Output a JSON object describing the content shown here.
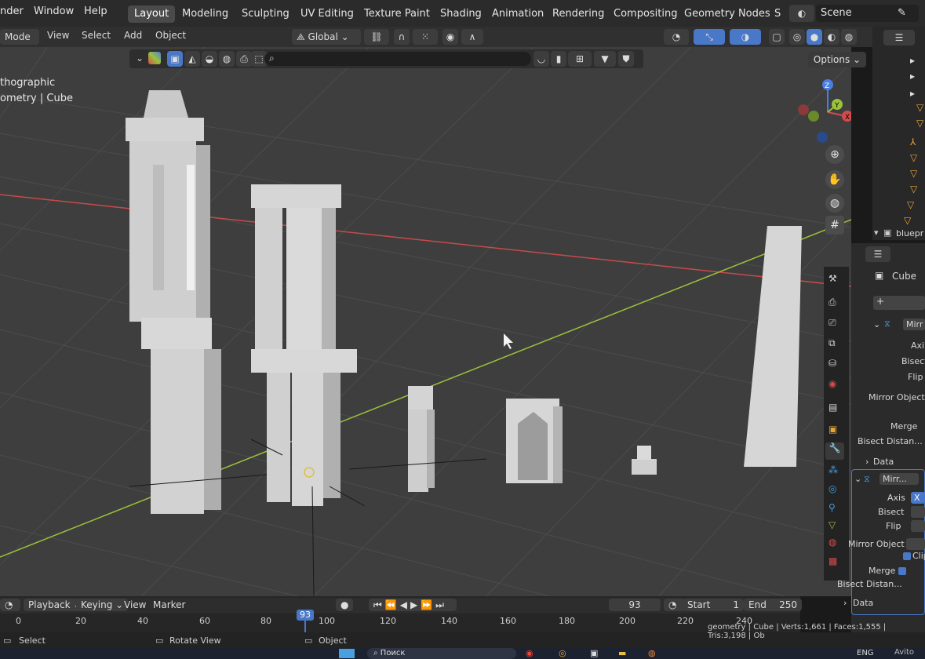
{
  "topbar": {
    "menus": [
      "nder",
      "Window",
      "Help"
    ],
    "workspaces": [
      "Layout",
      "Modeling",
      "Sculpting",
      "UV Editing",
      "Texture Paint",
      "Shading",
      "Animation",
      "Rendering",
      "Compositing",
      "Geometry Nodes",
      "S"
    ],
    "active_workspace": "Layout",
    "scene_label": "Scene"
  },
  "header": {
    "mode": "Mode",
    "menus": [
      "View",
      "Select",
      "Add",
      "Object"
    ],
    "transform_orientation": "Global",
    "options_label": "Options"
  },
  "viewport": {
    "view_name": "thographic",
    "collection_object": "ometry | Cube",
    "gizmo_axes": [
      "Z",
      "Y",
      "X"
    ],
    "nav_icons": [
      "zoom-icon",
      "hand-icon",
      "camera-icon",
      "grid-icon"
    ]
  },
  "timeline": {
    "menus": [
      "Playback",
      "Keying",
      "View",
      "Marker"
    ],
    "current_frame": "93",
    "start_label": "Start",
    "start_value": "1",
    "end_label": "End",
    "end_value": "250",
    "ticks": [
      "0",
      "20",
      "40",
      "60",
      "80",
      "100",
      "120",
      "140",
      "160",
      "180",
      "200",
      "220",
      "240"
    ]
  },
  "status": {
    "left_action": "Select",
    "mid_action": "Rotate View",
    "right_action": "Object",
    "info": "geometry | Cube | Verts:1,661 | Faces:1,555 | Tris:3,198 | Ob"
  },
  "taskbar": {
    "search": "Поиск",
    "lang": "ENG",
    "watermark": "Avito"
  },
  "outliner": {
    "last_item": "bluepr"
  },
  "properties": {
    "object_name": "Cube",
    "modifier1": {
      "name": "Mirr",
      "axis_label": "Axi",
      "bisect_label": "Bisect",
      "flip_label": "Flip",
      "mirror_object_label": "Mirror Object",
      "merge_label": "Merge",
      "bisect_distance_label": "Bisect Distan...",
      "data_label": "Data"
    },
    "modifier2": {
      "name": "Mirr...",
      "axis_label": "Axis",
      "bisect_label": "Bisect",
      "flip_label": "Flip",
      "axis_value": "X",
      "mirror_object_label": "Mirror Object",
      "clip_label": "Clip",
      "merge_label": "Merge",
      "bisect_distance_label": "Bisect Distan...",
      "data_label": "Data"
    }
  },
  "colors": {
    "accent": "#4a78c8",
    "x_axis": "#d44b4b",
    "y_axis": "#9bc23a",
    "z_axis": "#4a7fe0"
  }
}
